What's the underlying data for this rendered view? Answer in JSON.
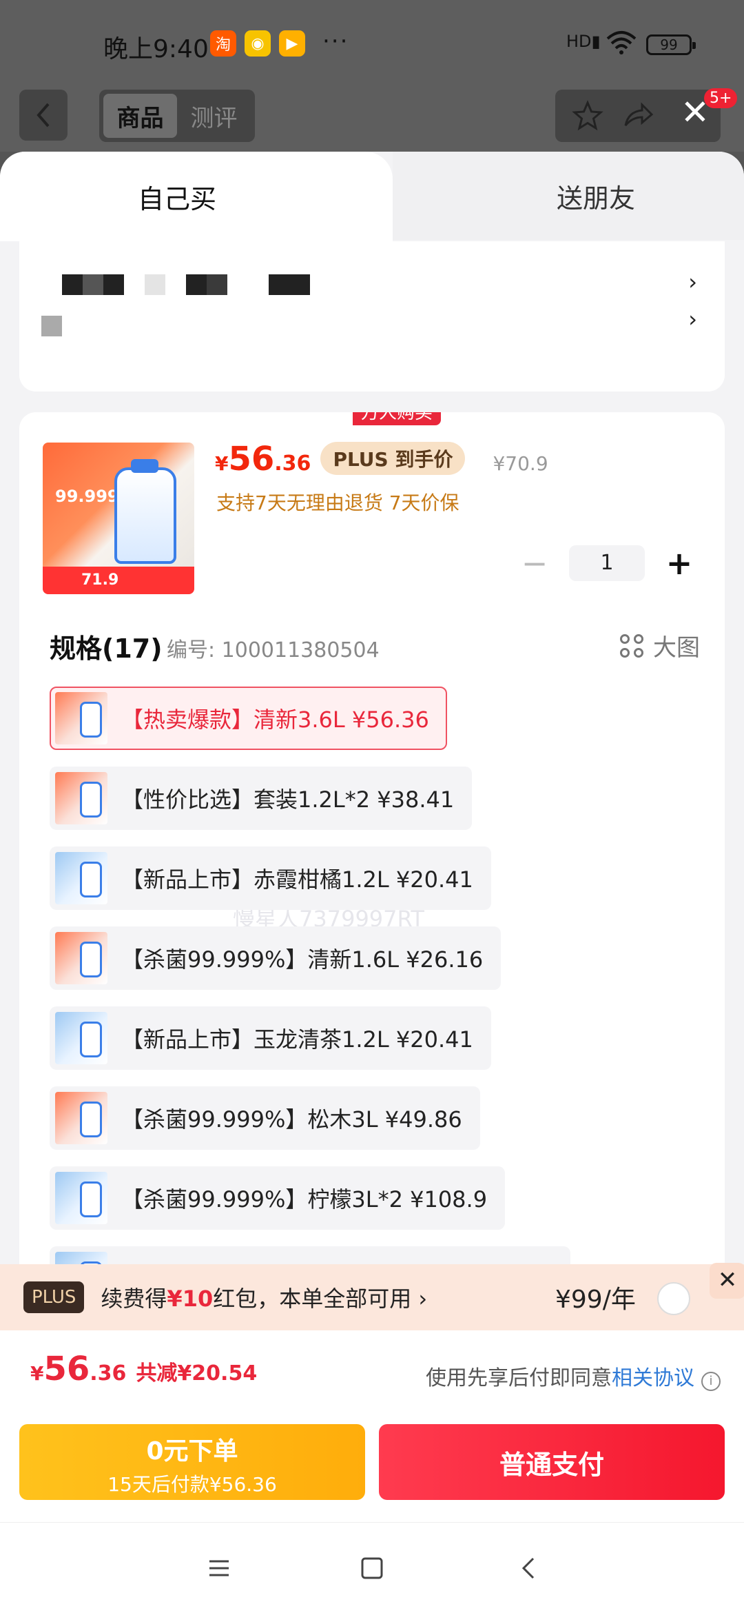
{
  "status": {
    "time": "晚上9:40",
    "network": "HD",
    "battery": "99",
    "more": "···"
  },
  "header": {
    "tabs": [
      {
        "label": "商品"
      },
      {
        "label": "测评"
      }
    ],
    "badge": "5+"
  },
  "sheet": {
    "tabs": {
      "self": "自己买",
      "friend": "送朋友"
    },
    "product": {
      "thumb_label": "99.999%",
      "thumb_price": "71.9",
      "price_symbol": "¥",
      "price_int": "56",
      "price_dec": ".36",
      "plus_pill": "PLUS 到手价",
      "original_price": "¥70.9",
      "return_policy": "支持7天无理由退货  7天价保",
      "quantity": "1"
    },
    "spec": {
      "title": "规格(17)",
      "number": "编号: 100011380504",
      "big_view": "大图",
      "hot_tag": "万人购买",
      "options": [
        {
          "label": "【热卖爆款】清新3.6L   ¥56.36"
        },
        {
          "label": "【性价比选】套装1.2L*2   ¥38.41"
        },
        {
          "label": "【新品上市】赤霞柑橘1.2L   ¥20.41"
        },
        {
          "label": "【杀菌99.999%】清新1.6L   ¥26.16"
        },
        {
          "label": "【新品上市】玉龙清茶1.2L   ¥20.41"
        },
        {
          "label": "【杀菌99.999%】松木3L   ¥49.86"
        },
        {
          "label": "【杀菌99.999%】柠檬3L*2   ¥108.9"
        }
      ],
      "watermark": "慢星人7379997RT"
    }
  },
  "plus_bar": {
    "logo": "PLUS",
    "text_prefix": "续费得",
    "text_red": "¥10",
    "text_suffix": "红包，本单全部可用 ›",
    "price": "¥99/年"
  },
  "total": {
    "symbol": "¥",
    "int": "56",
    "dec": ".36",
    "saving": "共减¥20.54",
    "agree_prefix": "使用先享后付即同意",
    "agree_link": "相关协议"
  },
  "buttons": {
    "left_line1": "0元下单",
    "left_line2": "15天后付款¥56.36",
    "right": "普通支付"
  },
  "colors": {
    "accent": "#e9273b",
    "plus_gold": "#f8e1c6",
    "pay_yellow": "#ffb611"
  }
}
